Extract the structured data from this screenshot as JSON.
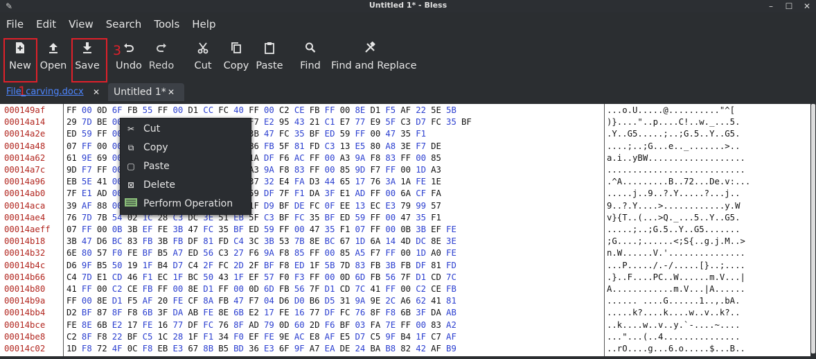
{
  "window": {
    "title": "Untitled 1* - Bless"
  },
  "menu": [
    "File",
    "Edit",
    "View",
    "Search",
    "Tools",
    "Help"
  ],
  "toolbar": {
    "new": "New",
    "open": "Open",
    "save": "Save",
    "undo": "Undo",
    "redo": "Redo",
    "cut": "Cut",
    "copy": "Copy",
    "paste": "Paste",
    "find": "Find",
    "find_replace": "Find and Replace"
  },
  "annotations": {
    "n1": "1",
    "n2": "2",
    "n3": "3"
  },
  "tabs": [
    {
      "label": "File_carving.docx",
      "active": false
    },
    {
      "label": "Untitled 1*",
      "active": true
    }
  ],
  "context_menu": {
    "items": [
      {
        "label": "Cut",
        "icon": "cut-icon"
      },
      {
        "label": "Copy",
        "icon": "copy-icon"
      },
      {
        "label": "Paste",
        "icon": "paste-icon"
      },
      {
        "label": "Delete",
        "icon": "delete-icon"
      },
      {
        "label": "Perform Operation",
        "icon": "operation-icon"
      }
    ]
  },
  "hex_rows": [
    {
      "offset": "000149af",
      "hex": "FF 00 0D 6F FB 55 FF 00 D1 CC FC 40 FF 00 C2 CE FB FF 00 8E D1 F5 AF 22 5E 5B",
      "ascii": "...o.U.....@..........\"^["
    },
    {
      "offset": "00014a14",
      "hex": "29 7D BE 00 56 71 00 00 05 05 70 B8 F7 E2 95 43 21 C1 E7 77 E9 5F C3 D7 FC 35 BF",
      "ascii": ")}....\"..p....C!..w._...5."
    },
    {
      "offset": "00014a2e",
      "hex": "ED 59 FF 00 47 35 FF 00 0B 3B EF FE 3B 47 FC 35 BF ED 59 FF 00 47 35 F1",
      "ascii": ".Y..G5.....;..;G.5..Y..G5."
    },
    {
      "offset": "00014a48",
      "hex": "07 FF 00 00 00 00 00 00 D6 BC 81 65 B6 FB 5F 81 FD C3 13 E5 80 A8 3E F7 DE",
      "ascii": "....;..;G...e.._.......>.."
    },
    {
      "offset": "00014a62",
      "hex": "61 9E 69 00 00 00 00 00 AF E1 EF FE 1A DF F6 AC FF 00 A3 9A F8 83 FF 00 85",
      "ascii": "a.i..yBW..................."
    },
    {
      "offset": "00014a7c",
      "hex": "9D F7 FF 00 00 00 00 00 F6 AC FF 00 A3 9A F8 83 FF 00 85 9D F7 FF 00 1D A3",
      "ascii": "..........................."
    },
    {
      "offset": "00014a96",
      "hex": "EB 5E 41 00 00 00 00 00 DC 42 C2 8E 37 32 E4 FA D3 44 65 17 76 3A 1A FE 1E",
      "ascii": ".^A.........B..72...De.v:..."
    },
    {
      "offset": "00014ab0",
      "hex": "7F E1 AD 00 00 00 00 00 AF 88 3F F8 59 DF 7F F1 DA 3F E1 AD FF 00 6A CF FA",
      "ascii": ".....j..9..?.Y.....?...j.."
    },
    {
      "offset": "00014aca",
      "hex": "39 AF 88 00 00 00 00 00 DA 3E B5 E4 1F D9 BF DE FC 0F EE 13 EC E3 79 99 57",
      "ascii": "9..?.Y....>............y.W"
    },
    {
      "offset": "00014ae4",
      "hex": "76 7D 7B 54 02 1C 28 C3 DC 3E 51 EB 5F C3 BF FC 35 BF ED 59 FF 00 47 35 F1",
      "ascii": "v}{T..(...>Q._...5..Y..G5."
    },
    {
      "offset": "00014aeff",
      "hex": "07 FF 00 0B 3B EF FE 3B 47 FC 35 BF ED 59 FF 00 47 35 F1 07 FF 00 0B 3B EF FE",
      "ascii": ".....;..;G.5..Y..G5......."
    },
    {
      "offset": "00014b18",
      "hex": "3B 47 D6 BC 83 FB 3B FB DF 81 FD C4 3C 3B 53 7B 8E BC 67 1D 6A 14 4D DC 8E 3E",
      "ascii": ";G....;......<;S{..g.j.M..>"
    },
    {
      "offset": "00014b32",
      "hex": "6E 80 57 F0 FE BF B5 A7 ED 56 C3 27 F6 9A F8 85 FF 00 85 A5 F7 FF 00 1D A0 FE",
      "ascii": "n.W......V.'..............."
    },
    {
      "offset": "00014b4c",
      "hex": "D6 9F B5 50 19 1F B4 D7 C4 2F FC 2D 2F BF F8 ED 1F 5B 7D 83 FB 3B FB DF 81 FD",
      "ascii": "...P...../.-/.....[}..;...."
    },
    {
      "offset": "00014b66",
      "hex": "C4 7D E1 CD 46 F1 EC 1F BC 50 43 1F EF 57 F0 F3 FF 00 0D 6D FB 56 7F D1 CD 7C",
      "ascii": ".}..F....PC..W......m.V...|"
    },
    {
      "offset": "00014b80",
      "hex": "41 FF 00 C2 CE FB FF 00 8E D1 FF 00 0D 6D FB 56 7F D1 CD 7C 41 FF 00 C2 CE FB",
      "ascii": "A............m.V...|A......"
    },
    {
      "offset": "00014b9a",
      "hex": "FF 00 8E D1 F5 AF 20 FE CF 8A FB 47 F7 04 D6 D0 B6 D5 31 9A 9E 2C A6 62 41 81",
      "ascii": "...... ....G......1..,.bA."
    },
    {
      "offset": "00014bb4",
      "hex": "D2 BF 87 8F F8 6B 3F DA AB FE 8E 6B E2 17 FE 16 77 DF FC 76 8F F8 6B 3F DA AB",
      "ascii": ".....k?....k....w..v..k?.."
    },
    {
      "offset": "00014bce",
      "hex": "FE 8E 6B E2 17 FE 16 77 DF FC 76 8F AD 79 0D 60 2D F6 BF 03 FA 7E FF 00 83 A2",
      "ascii": "..k....w..v..y.`-....~...."
    },
    {
      "offset": "00014be8",
      "hex": "C2 8F F8 22 BF C5 1C 28 1F F1 34 F0 EF FE 9E AC E8 AF E5 D7 C5 9F B4 1F C7 AF",
      "ascii": "...\"...(..4..............."
    },
    {
      "offset": "00014c02",
      "hex": "1D F8 72 4F 0C F8 EB E3 67 8B B5 BD 36 E3 6F 9F A7 EA DE 24 BA B8 82 42 AF B9",
      "ascii": "..rO....g...6.o.....$...B.."
    }
  ]
}
